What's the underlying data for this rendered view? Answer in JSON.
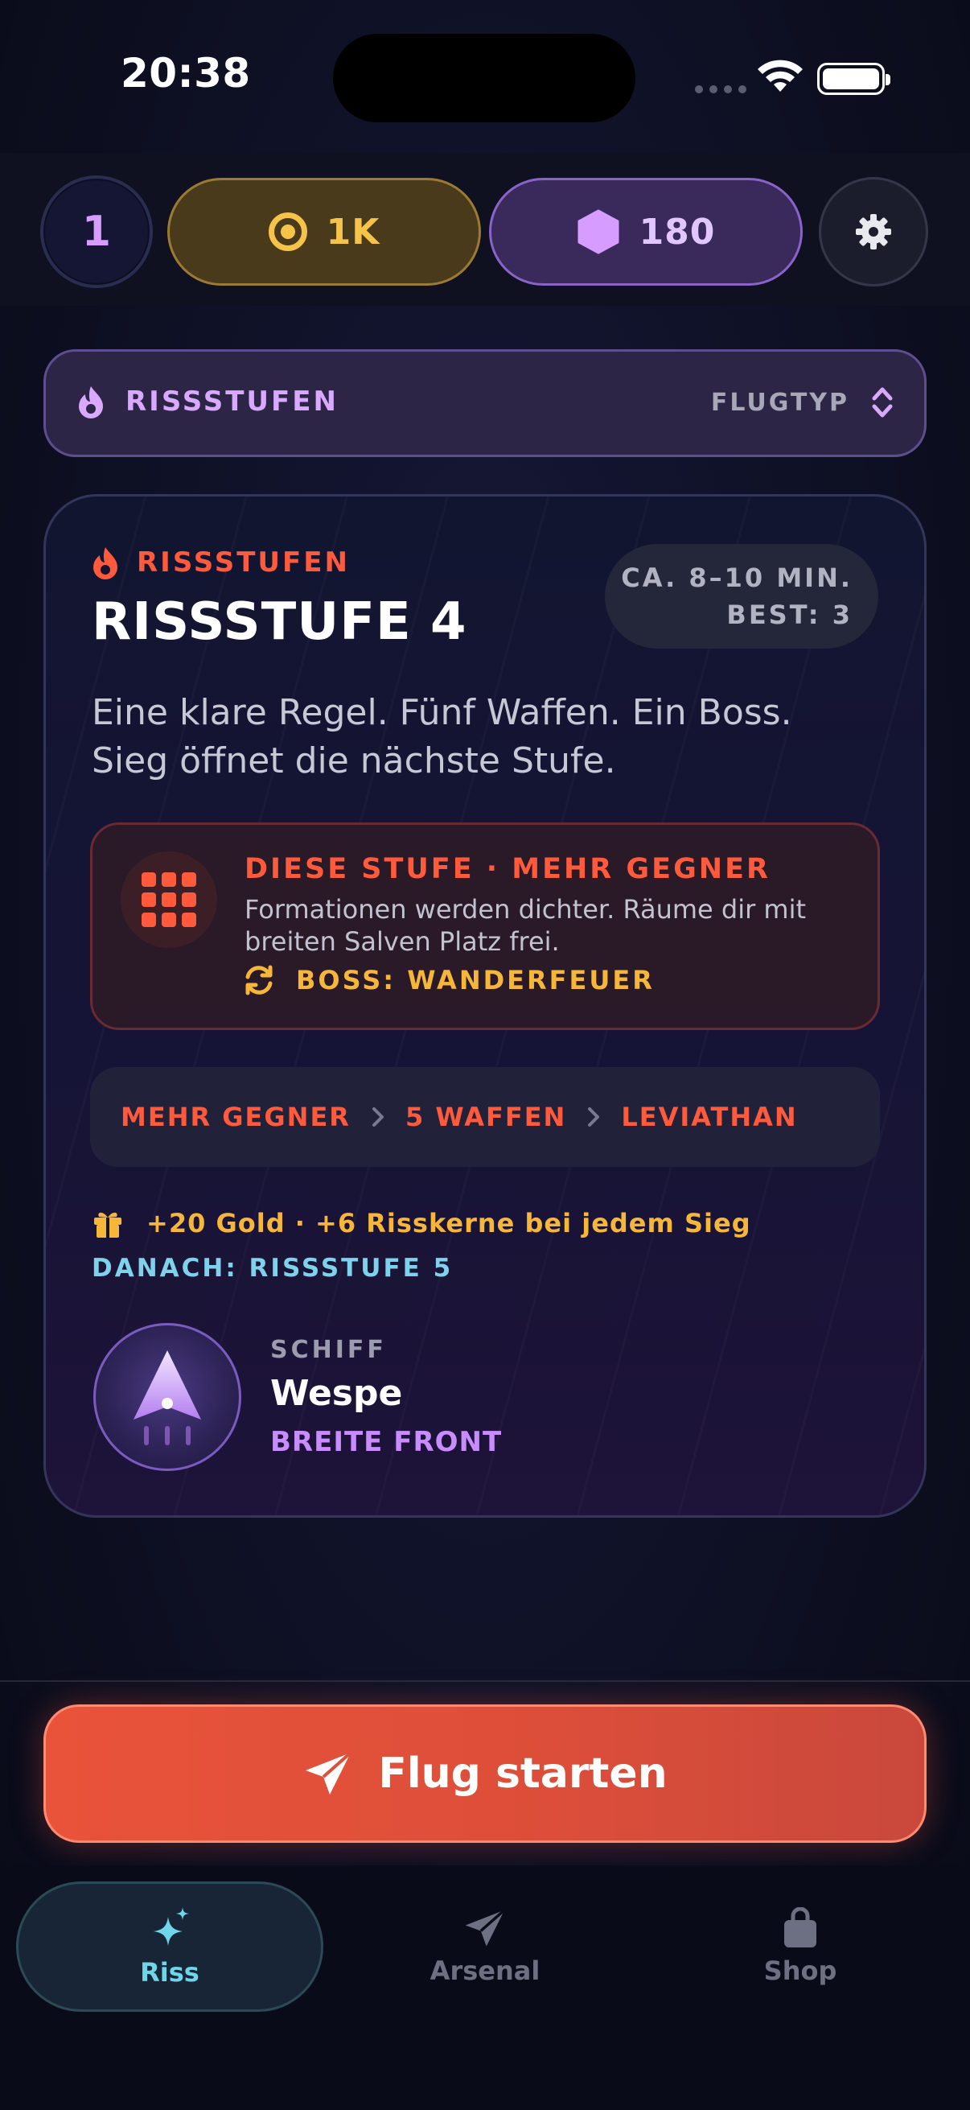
{
  "status_bar": {
    "time": "20:38"
  },
  "header": {
    "level": "1",
    "gold": "1K",
    "gems": "180"
  },
  "mode_selector": {
    "label": "RISSSTUFEN",
    "type_label": "FLUGTYP"
  },
  "stage_card": {
    "tag": "RISSSTUFEN",
    "title": "RISSSTUFE 4",
    "duration": "CA. 8–10 MIN.",
    "best": "BEST: 3",
    "description": "Eine klare Regel. Fünf Waffen. Ein Boss. Sieg öffnet die nächste Stufe.",
    "modifier": {
      "title": "DIESE STUFE · MEHR GEGNER",
      "description": "Formationen werden dichter. Räume dir mit breiten Salven Platz frei.",
      "boss": "BOSS: WANDERFEUER"
    },
    "path": [
      "MEHR GEGNER",
      "5 WAFFEN",
      "LEVIATHAN"
    ],
    "reward": "+20 Gold · +6 Risskerne bei jedem Sieg",
    "next": "DANACH: RISSSTUFE 5",
    "ship": {
      "label": "SCHIFF",
      "name": "Wespe",
      "trait": "BREITE FRONT"
    }
  },
  "start_button": {
    "label": "Flug starten"
  },
  "tabs": [
    {
      "label": "Riss",
      "icon": "sparkles-icon",
      "active": true
    },
    {
      "label": "Arsenal",
      "icon": "paper-plane-icon",
      "active": false
    },
    {
      "label": "Shop",
      "icon": "shopping-bag-icon",
      "active": false
    }
  ],
  "colors": {
    "accent_red": "#ff5a3c",
    "gold": "#f6c34a",
    "purple": "#d9a8ff",
    "cyan": "#6fd6ea"
  }
}
